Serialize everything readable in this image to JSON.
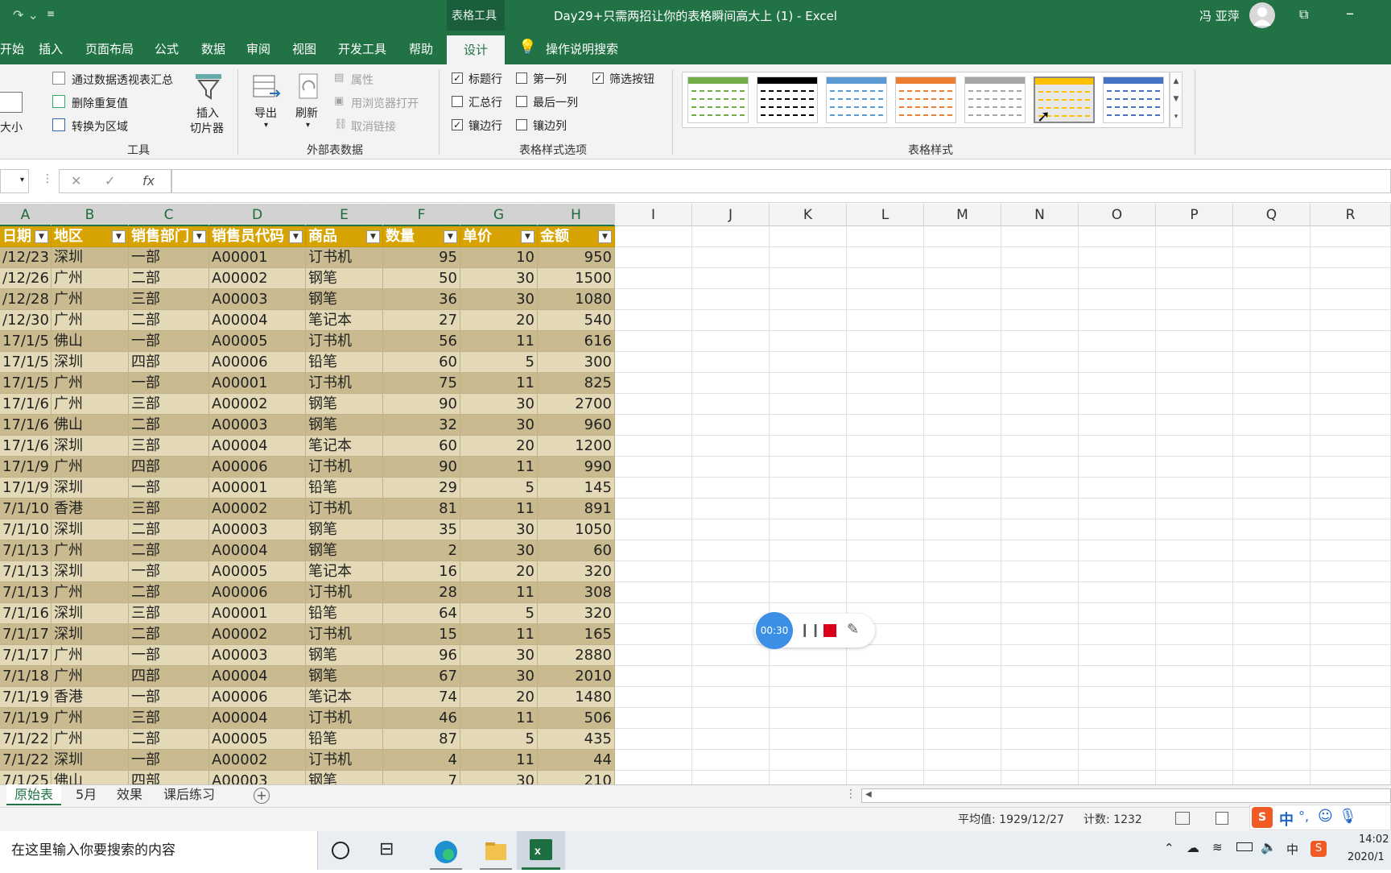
{
  "title_bar": {
    "context_tab": "表格工具",
    "document_title": "Day29+只需两招让你的表格瞬间高大上 (1)  -  Excel",
    "user_name": "冯 亚萍"
  },
  "ribbon_tabs": [
    "开始",
    "插入",
    "页面布局",
    "公式",
    "数据",
    "审阅",
    "视图",
    "开发工具",
    "帮助",
    "设计"
  ],
  "active_tab": "设计",
  "tell_me": "操作说明搜索",
  "ribbon": {
    "resize_label": "大小",
    "tools": {
      "pivot": "通过数据透视表汇总",
      "dedupe": "删除重复值",
      "convert": "转换为区域",
      "slicer_l1": "插入",
      "slicer_l2": "切片器",
      "group": "工具"
    },
    "external": {
      "export": "导出",
      "refresh": "刷新",
      "properties": "属性",
      "open_browser": "用浏览器打开",
      "unlink": "取消链接",
      "group": "外部表数据"
    },
    "style_options": {
      "header_row": "标题行",
      "first_col": "第一列",
      "filter_btn": "筛选按钮",
      "total_row": "汇总行",
      "last_col": "最后一列",
      "banded_rows": "镶边行",
      "banded_cols": "镶边列",
      "group": "表格样式选项",
      "checked": {
        "header_row": true,
        "first_col": false,
        "filter_btn": true,
        "total_row": false,
        "last_col": false,
        "banded_rows": true,
        "banded_cols": false
      }
    },
    "table_styles": {
      "group": "表格样式",
      "swatches": [
        "#70ad47",
        "#000000",
        "#5b9bd5",
        "#ed7d31",
        "#a5a5a5",
        "#ffc000",
        "#4472c4"
      ],
      "selected_index": 5
    }
  },
  "formula_bar": {
    "fx": "fx",
    "cancel": "✕",
    "confirm": "✓"
  },
  "columns": [
    "A",
    "B",
    "C",
    "D",
    "E",
    "F",
    "G",
    "H",
    "I",
    "J",
    "K",
    "L",
    "M",
    "N",
    "O",
    "P",
    "Q",
    "R"
  ],
  "table_headers": [
    "日期",
    "地区",
    "销售部门",
    "销售员代码",
    "商品",
    "数量",
    "单价",
    "金额"
  ],
  "rows": [
    [
      "/12/23",
      "深圳",
      "一部",
      "A00001",
      "订书机",
      "95",
      "10",
      "950"
    ],
    [
      "/12/26",
      "广州",
      "二部",
      "A00002",
      "钢笔",
      "50",
      "30",
      "1500"
    ],
    [
      "/12/28",
      "广州",
      "三部",
      "A00003",
      "钢笔",
      "36",
      "30",
      "1080"
    ],
    [
      "/12/30",
      "广州",
      "二部",
      "A00004",
      "笔记本",
      "27",
      "20",
      "540"
    ],
    [
      "17/1/5",
      "佛山",
      "一部",
      "A00005",
      "订书机",
      "56",
      "11",
      "616"
    ],
    [
      "17/1/5",
      "深圳",
      "四部",
      "A00006",
      "铅笔",
      "60",
      "5",
      "300"
    ],
    [
      "17/1/5",
      "广州",
      "一部",
      "A00001",
      "订书机",
      "75",
      "11",
      "825"
    ],
    [
      "17/1/6",
      "广州",
      "三部",
      "A00002",
      "钢笔",
      "90",
      "30",
      "2700"
    ],
    [
      "17/1/6",
      "佛山",
      "二部",
      "A00003",
      "钢笔",
      "32",
      "30",
      "960"
    ],
    [
      "17/1/6",
      "深圳",
      "三部",
      "A00004",
      "笔记本",
      "60",
      "20",
      "1200"
    ],
    [
      "17/1/9",
      "广州",
      "四部",
      "A00006",
      "订书机",
      "90",
      "11",
      "990"
    ],
    [
      "17/1/9",
      "深圳",
      "一部",
      "A00001",
      "铅笔",
      "29",
      "5",
      "145"
    ],
    [
      "7/1/10",
      "香港",
      "三部",
      "A00002",
      "订书机",
      "81",
      "11",
      "891"
    ],
    [
      "7/1/10",
      "深圳",
      "二部",
      "A00003",
      "钢笔",
      "35",
      "30",
      "1050"
    ],
    [
      "7/1/13",
      "广州",
      "二部",
      "A00004",
      "钢笔",
      "2",
      "30",
      "60"
    ],
    [
      "7/1/13",
      "深圳",
      "一部",
      "A00005",
      "笔记本",
      "16",
      "20",
      "320"
    ],
    [
      "7/1/13",
      "广州",
      "二部",
      "A00006",
      "订书机",
      "28",
      "11",
      "308"
    ],
    [
      "7/1/16",
      "深圳",
      "三部",
      "A00001",
      "铅笔",
      "64",
      "5",
      "320"
    ],
    [
      "7/1/17",
      "深圳",
      "二部",
      "A00002",
      "订书机",
      "15",
      "11",
      "165"
    ],
    [
      "7/1/17",
      "广州",
      "一部",
      "A00003",
      "钢笔",
      "96",
      "30",
      "2880"
    ],
    [
      "7/1/18",
      "广州",
      "四部",
      "A00004",
      "钢笔",
      "67",
      "30",
      "2010"
    ],
    [
      "7/1/19",
      "香港",
      "一部",
      "A00006",
      "笔记本",
      "74",
      "20",
      "1480"
    ],
    [
      "7/1/19",
      "广州",
      "三部",
      "A00004",
      "订书机",
      "46",
      "11",
      "506"
    ],
    [
      "7/1/22",
      "广州",
      "二部",
      "A00005",
      "铅笔",
      "87",
      "5",
      "435"
    ],
    [
      "7/1/22",
      "深圳",
      "一部",
      "A00002",
      "订书机",
      "4",
      "11",
      "44"
    ],
    [
      "7/1/25",
      "佛山",
      "四部",
      "A00003",
      "钢笔",
      "7",
      "30",
      "210"
    ]
  ],
  "table_colors": {
    "header": "#d6a300",
    "band_dark": "#c9bb8f",
    "band_light": "#e4d9b6",
    "border": "#bdb28a"
  },
  "sheet_tabs": [
    "原始表",
    "5月",
    "效果",
    "课后练习"
  ],
  "active_sheet": "原始表",
  "status": {
    "average": "平均值: 1929/12/27",
    "count": "计数: 1232"
  },
  "recorder": {
    "time": "00:30"
  },
  "ime": {
    "label": "中"
  },
  "taskbar": {
    "search_placeholder": "在这里输入你要搜索的内容",
    "clock_time": "14:02",
    "clock_date": "2020/1",
    "ime_char": "中"
  }
}
